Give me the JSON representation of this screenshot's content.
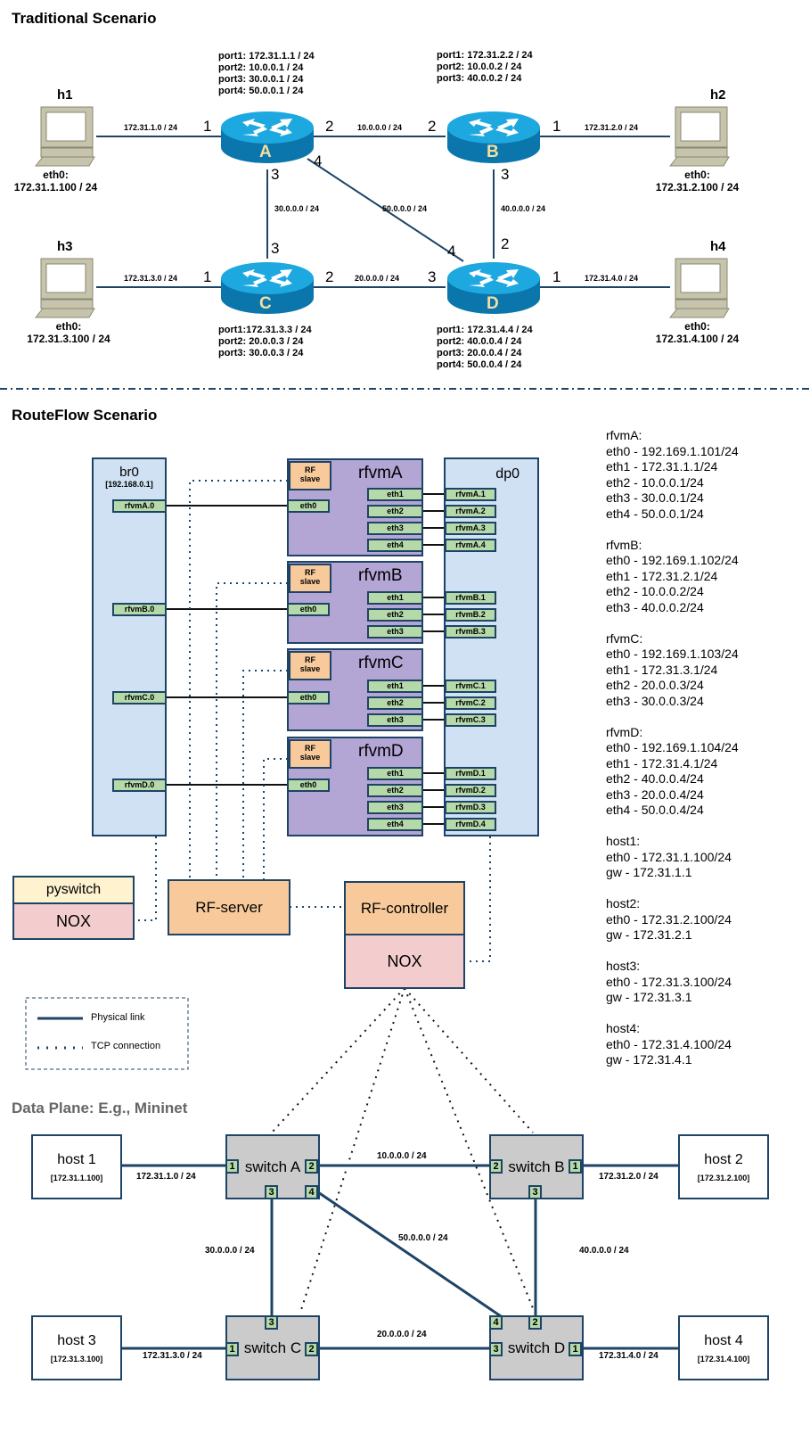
{
  "traditional": {
    "title": "Traditional Scenario",
    "routers": {
      "A": {
        "label": "A",
        "ports": [
          "port1: 172.31.1.1 / 24",
          "port2: 10.0.0.1 / 24",
          "port3: 30.0.0.1 / 24",
          "port4: 50.0.0.1 / 24"
        ]
      },
      "B": {
        "label": "B",
        "ports": [
          "port1: 172.31.2.2 / 24",
          "port2: 10.0.0.2 / 24",
          "port3: 40.0.0.2 / 24"
        ]
      },
      "C": {
        "label": "C",
        "ports": [
          "port1:172.31.3.3 / 24",
          "port2: 20.0.0.3 / 24",
          "port3: 30.0.0.3 / 24"
        ]
      },
      "D": {
        "label": "D",
        "ports": [
          "port1: 172.31.4.4 / 24",
          "port2: 40.0.0.4 / 24",
          "port3: 20.0.0.4 / 24",
          "port4: 50.0.0.4 / 24"
        ]
      }
    },
    "hosts": {
      "h1": {
        "name": "h1",
        "iface": "eth0:",
        "ip": "172.31.1.100 / 24"
      },
      "h2": {
        "name": "h2",
        "iface": "eth0:",
        "ip": "172.31.2.100 / 24"
      },
      "h3": {
        "name": "h3",
        "iface": "eth0:",
        "ip": "172.31.3.100 / 24"
      },
      "h4": {
        "name": "h4",
        "iface": "eth0:",
        "ip": "172.31.4.100 / 24"
      }
    },
    "links": {
      "h1_A": "172.31.1.0 / 24",
      "A_B": "10.0.0.0 / 24",
      "B_h2": "172.31.2.0 / 24",
      "A_C": "30.0.0.0 / 24",
      "A_D": "50.0.0.0 / 24",
      "B_D": "40.0.0.0 / 24",
      "h3_C": "172.31.3.0 / 24",
      "C_D": "20.0.0.0 / 24",
      "D_h4": "172.31.4.0 / 24"
    },
    "port_numbers": {
      "A1": "1",
      "A2": "2",
      "A3": "3",
      "A4": "4",
      "B2": "2",
      "B1": "1",
      "B3": "3",
      "C3": "3",
      "C1": "1",
      "C2": "2",
      "D4": "4",
      "D2": "2",
      "D3": "3",
      "D1": "1"
    }
  },
  "routeflow": {
    "title": "RouteFlow Scenario",
    "br0": {
      "name": "br0",
      "ip": "[192.168.0.1]",
      "ports": [
        "rfvmA.0",
        "rfvmB.0",
        "rfvmC.0",
        "rfvmD.0"
      ]
    },
    "dp0": {
      "name": "dp0",
      "ports": [
        "rfvmA.1",
        "rfvmA.2",
        "rfvmA.3",
        "rfvmA.4",
        "rfvmB.1",
        "rfvmB.2",
        "rfvmB.3",
        "rfvmC.1",
        "rfvmC.2",
        "rfvmC.3",
        "rfvmD.1",
        "rfvmD.2",
        "rfvmD.3",
        "rfvmD.4"
      ]
    },
    "vms": [
      {
        "name": "rfvmA",
        "slave": "RF\nslave",
        "slave_l1": "RF",
        "slave_l2": "slave",
        "eth0": "eth0",
        "eths": [
          "eth1",
          "eth2",
          "eth3",
          "eth4"
        ]
      },
      {
        "name": "rfvmB",
        "slave_l1": "RF",
        "slave_l2": "slave",
        "eth0": "eth0",
        "eths": [
          "eth1",
          "eth2",
          "eth3"
        ]
      },
      {
        "name": "rfvmC",
        "slave_l1": "RF",
        "slave_l2": "slave",
        "eth0": "eth0",
        "eths": [
          "eth1",
          "eth2",
          "eth3"
        ]
      },
      {
        "name": "rfvmD",
        "slave_l1": "RF",
        "slave_l2": "slave",
        "eth0": "eth0",
        "eths": [
          "eth1",
          "eth2",
          "eth3",
          "eth4"
        ]
      }
    ],
    "pyswitch": "pyswitch",
    "nox_left": "NOX",
    "rf_server": "RF-server",
    "rf_controller": "RF-controller",
    "nox_right": "NOX",
    "legend": {
      "physical": "Physical link",
      "tcp": "TCP connection"
    },
    "config": [
      {
        "title": "rfvmA:",
        "lines": [
          "eth0 - 192.169.1.101/24",
          "eth1 - 172.31.1.1/24",
          "eth2 - 10.0.0.1/24",
          "eth3 - 30.0.0.1/24",
          "eth4 - 50.0.0.1/24"
        ]
      },
      {
        "title": "rfvmB:",
        "lines": [
          "eth0 - 192.169.1.102/24",
          "eth1 - 172.31.2.1/24",
          "eth2 - 10.0.0.2/24",
          "eth3 - 40.0.0.2/24"
        ]
      },
      {
        "title": "rfvmC:",
        "lines": [
          "eth0 - 192.169.1.103/24",
          "eth1 - 172.31.3.1/24",
          "eth2 - 20.0.0.3/24",
          "eth3 - 30.0.0.3/24"
        ]
      },
      {
        "title": "rfvmD:",
        "lines": [
          "eth0 - 192.169.1.104/24",
          "eth1 - 172.31.4.1/24",
          "eth2 - 40.0.0.4/24",
          "eth3 - 20.0.0.4/24",
          "eth4 - 50.0.0.4/24"
        ]
      },
      {
        "title": "host1:",
        "lines": [
          "eth0 - 172.31.1.100/24",
          "gw - 172.31.1.1"
        ]
      },
      {
        "title": "host2:",
        "lines": [
          "eth0 - 172.31.2.100/24",
          "gw - 172.31.2.1"
        ]
      },
      {
        "title": "host3:",
        "lines": [
          "eth0 - 172.31.3.100/24",
          "gw - 172.31.3.1"
        ]
      },
      {
        "title": "host4:",
        "lines": [
          "eth0 - 172.31.4.100/24",
          "gw - 172.31.4.1"
        ]
      }
    ]
  },
  "dataplane": {
    "title": "Data Plane: E.g., Mininet",
    "hosts": [
      {
        "name": "host 1",
        "ip": "[172.31.1.100]"
      },
      {
        "name": "host 2",
        "ip": "[172.31.2.100]"
      },
      {
        "name": "host 3",
        "ip": "[172.31.3.100]"
      },
      {
        "name": "host 4",
        "ip": "[172.31.4.100]"
      }
    ],
    "switches": [
      "switch A",
      "switch B",
      "switch C",
      "switch D"
    ],
    "ports": {
      "A1": "1",
      "A2": "2",
      "A3": "3",
      "A4": "4",
      "B2": "2",
      "B1": "1",
      "B3": "3",
      "C3": "3",
      "C1": "1",
      "C2": "2",
      "D4": "4",
      "D2": "2",
      "D3": "3",
      "D1": "1"
    },
    "links": {
      "h1_A": "172.31.1.0 / 24",
      "A_B": "10.0.0.0 / 24",
      "B_h2": "172.31.2.0 / 24",
      "A_C": "30.0.0.0 / 24",
      "A_D": "50.0.0.0 / 24",
      "B_D": "40.0.0.0 / 24",
      "h3_C": "172.31.3.0 / 24",
      "C_D": "20.0.0.0 / 24",
      "D_h4": "172.31.4.0 / 24"
    }
  },
  "colors": {
    "link": "#1d4466",
    "router_top": "#1ea8e0",
    "router_side": "#0a76ab",
    "router_label": "#f5dfa0",
    "vm_purple": "#b3a5d4",
    "bridge_blue": "#cfe1f3",
    "port_green": "#b5d9a8",
    "rf_orange": "#f8ca9b",
    "nox_pink": "#f3cdcd",
    "pyswitch_cream": "#fff2cf",
    "switch_grey": "#cbcbcb"
  }
}
